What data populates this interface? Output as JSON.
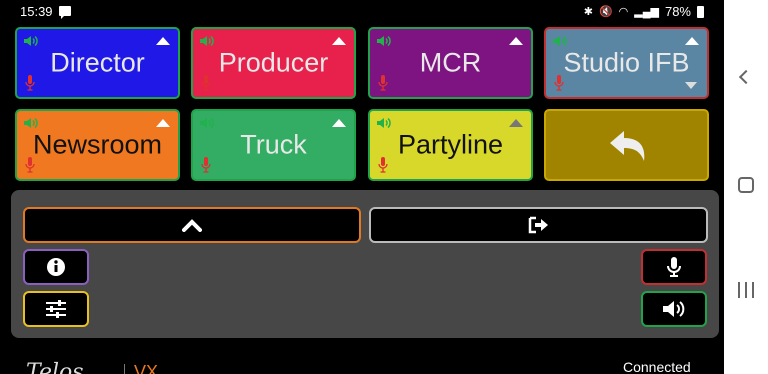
{
  "status_bar": {
    "time": "15:39",
    "battery": "78%"
  },
  "keys": [
    {
      "label": "Director",
      "bg": "#1f18e6",
      "border": "#21a34a",
      "text": "#e8e8e8",
      "tri": "up",
      "spk": "#22b24c",
      "mic": "#e03030"
    },
    {
      "label": "Producer",
      "bg": "#e8204c",
      "border": "#21a34a",
      "text": "#e8e8e8",
      "tri": "up",
      "spk": "#22b24c",
      "mic": "#e03030"
    },
    {
      "label": "MCR",
      "bg": "#7e1482",
      "border": "#21a34a",
      "text": "#e8e8e8",
      "tri": "up",
      "spk": "#22b24c",
      "mic": "#e03030"
    },
    {
      "label": "Studio IFB",
      "bg": "#5a86a3",
      "border": "#c03030",
      "text": "#e8e8e8",
      "tri": "both",
      "spk": "#22b24c",
      "mic": "#e03030"
    },
    {
      "label": "Newsroom",
      "bg": "#f07820",
      "border": "#21a34a",
      "text": "#111111",
      "tri": "up",
      "spk": "#22b24c",
      "mic": "#e03030"
    },
    {
      "label": "Truck",
      "bg": "#33ac64",
      "border": "#21a34a",
      "text": "#e8e8e8",
      "tri": "up",
      "spk": "#22b24c",
      "mic": "#e03030"
    },
    {
      "label": "Partyline",
      "bg": "#d8d82a",
      "border": "#21a34a",
      "text": "#111111",
      "tri": "up-dim",
      "spk": "#22b24c",
      "mic": "#e03030"
    },
    {
      "label": "",
      "bg": "#a08400",
      "border": "#c8a800",
      "text": "#eeeeee",
      "tri": "none",
      "icon": "back-arrow-icon"
    }
  ],
  "controls": {
    "expand": {
      "icon": "chevron-up-icon",
      "border": "#e07a22"
    },
    "exit": {
      "icon": "sign-out-icon",
      "border": "#bbbbbb"
    },
    "info": {
      "icon": "info-icon",
      "border": "#8a5fbf"
    },
    "settings": {
      "icon": "sliders-icon",
      "border": "#e8c020"
    },
    "mic": {
      "icon": "microphone-icon",
      "border": "#c03030"
    },
    "speaker": {
      "icon": "speaker-icon",
      "border": "#21a34a"
    }
  },
  "footer": {
    "brand": "Telos",
    "product": "VX",
    "connection": "Connected"
  }
}
